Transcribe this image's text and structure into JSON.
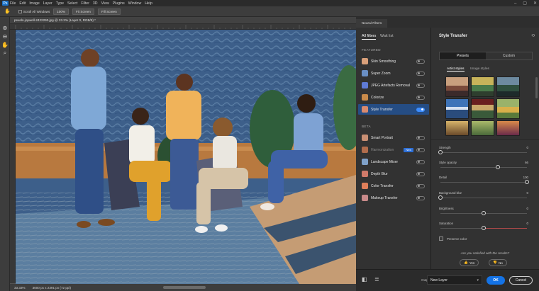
{
  "app": {
    "logo": "Ps"
  },
  "menubar": {
    "items": [
      "File",
      "Edit",
      "Image",
      "Layer",
      "Type",
      "Select",
      "Filter",
      "3D",
      "View",
      "Plugins",
      "Window",
      "Help"
    ]
  },
  "options_bar": {
    "scroll_all_windows": "Scroll All Windows",
    "zoom": "100%",
    "fit_screen": "Fit Screen",
    "fill_screen": "Fill Screen"
  },
  "document": {
    "tab_label": "pexels-jopwell-2422290.jpg @ 33.3% (Layer 0, RGB/8) *"
  },
  "status": {
    "zoom": "33.33%",
    "dimensions": "3600 px x 2391 px (72 ppi)"
  },
  "neural_filters": {
    "panel_tab": "Neural Filters",
    "tabs": {
      "all": "All filters",
      "wait": "Wait list"
    },
    "featured_heading": "FEATURED",
    "beta_heading": "BETA",
    "featured": [
      {
        "label": "Skin Smoothing",
        "on": false,
        "color": "#d9a07a"
      },
      {
        "label": "Super Zoom",
        "on": false,
        "color": "#6a8fc4"
      },
      {
        "label": "JPEG Artefacts Removal",
        "on": false,
        "color": "#5f7bd6"
      },
      {
        "label": "Colorize",
        "on": false,
        "color": "#c98a4a"
      },
      {
        "label": "Style Transfer",
        "on": true,
        "color": "#d98a6e"
      }
    ],
    "beta": [
      {
        "label": "Smart Portrait",
        "on": false,
        "color": "#c98f74",
        "dim": false,
        "badge": ""
      },
      {
        "label": "Harmonization",
        "on": false,
        "color": "#b06c4c",
        "dim": true,
        "badge": "New"
      },
      {
        "label": "Landscape Mixer",
        "on": false,
        "color": "#7fa1c9",
        "dim": false,
        "badge": ""
      },
      {
        "label": "Depth Blur",
        "on": false,
        "color": "#d07a6a",
        "dim": false,
        "badge": ""
      },
      {
        "label": "Color Transfer",
        "on": false,
        "color": "#e07f5a",
        "dim": false,
        "badge": ""
      },
      {
        "label": "Makeup Transfer",
        "on": false,
        "color": "#c98a8a",
        "dim": false,
        "badge": ""
      }
    ]
  },
  "style_transfer": {
    "title": "Style Transfer",
    "segments": {
      "presets": "Presets",
      "custom": "Custom"
    },
    "subtabs": {
      "artist": "Artist styles",
      "image": "Image styles"
    },
    "params": [
      {
        "label": "Strength",
        "value": "0",
        "level": 0
      },
      {
        "label": "Style opacity",
        "value": "66",
        "level": 0.66
      },
      {
        "label": "Detail",
        "value": "100",
        "level": 1.0
      },
      {
        "label": "Background blur",
        "value": "0",
        "level": 0
      },
      {
        "label": "Brightness",
        "value": "0",
        "level": 0.5
      },
      {
        "label": "Saturation",
        "value": "0",
        "level": 0.5
      }
    ],
    "preserve_color": "Preserve color",
    "satisfied": "Are you satisfied with the results?",
    "yes": "Yes",
    "no": "No"
  },
  "footer": {
    "output_label": "Output",
    "output_value": "New Layer",
    "ok": "OK",
    "cancel": "Cancel"
  }
}
